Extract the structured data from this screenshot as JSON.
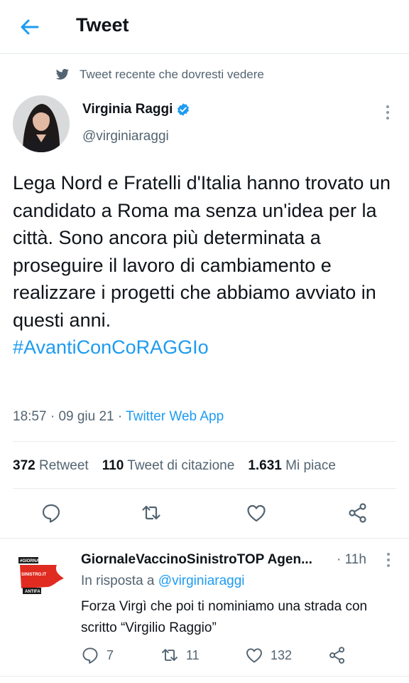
{
  "header": {
    "title": "Tweet",
    "back_icon": "arrow-left-icon"
  },
  "context": {
    "text": "Tweet recente che dovresti vedere",
    "icon": "twitter-bird-icon"
  },
  "tweet": {
    "author_name": "Virginia Raggi",
    "author_handle": "@virginiaraggi",
    "verified": true,
    "text": "Lega Nord e Fratelli d'Italia hanno trovato un candidato a Roma ma senza un'idea per la città. Sono ancora più determinata a proseguire il lavoro di cambiamento e realizzare i progetti che abbiamo avviato in questi anni.",
    "hashtag": "#AvantiConCoRAGGIo",
    "time": "18:57",
    "date": "09 giu 21",
    "source": "Twitter Web App",
    "sep": "·"
  },
  "stats": {
    "retweets": "372",
    "retweets_label": "Retweet",
    "quotes": "110",
    "quotes_label": "Tweet di citazione",
    "likes": "1.631",
    "likes_label": "Mi piace"
  },
  "reply": {
    "author_name": "GiornaleVaccinoSinistroTOP Agen...",
    "sep": "·",
    "time": "11h",
    "replying_prefix": "In risposta a",
    "replying_to": "@virginiaraggi",
    "text": "Forza Virgì che poi ti nominiamo una strada con scritto “Virgilio Raggio”",
    "replies": "7",
    "retweets": "11",
    "likes": "132",
    "avatar_text": {
      "line1": "#GIORNALE",
      "line2": "SINISTRO.IT",
      "line3": "ANTIFA"
    }
  },
  "colors": {
    "accent": "#1d9bf0",
    "secondary": "#536471",
    "text": "#0f1419",
    "divider": "#e8ecef"
  }
}
